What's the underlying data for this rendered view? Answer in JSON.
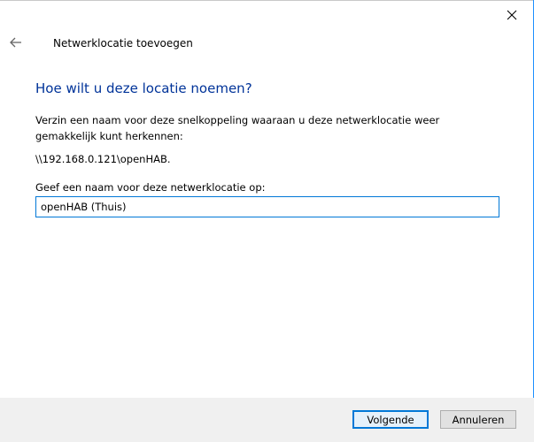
{
  "header": {
    "title": "Netwerklocatie toevoegen",
    "back_icon": "back-arrow-icon",
    "close_icon": "close-icon"
  },
  "main": {
    "heading": "Hoe wilt u deze locatie noemen?",
    "description": "Verzin een naam voor deze snelkoppeling waaraan u deze netwerklocatie weer gemakkelijk kunt herkennen:",
    "network_path": "\\\\192.168.0.121\\openHAB.",
    "name_label": "Geef een naam voor deze netwerklocatie op:",
    "name_value": "openHAB (Thuis)"
  },
  "footer": {
    "next_label": "Volgende",
    "cancel_label": "Annuleren"
  },
  "colors": {
    "heading": "#003399",
    "accent": "#0078d7",
    "footer_bg": "#f0f0f0"
  }
}
